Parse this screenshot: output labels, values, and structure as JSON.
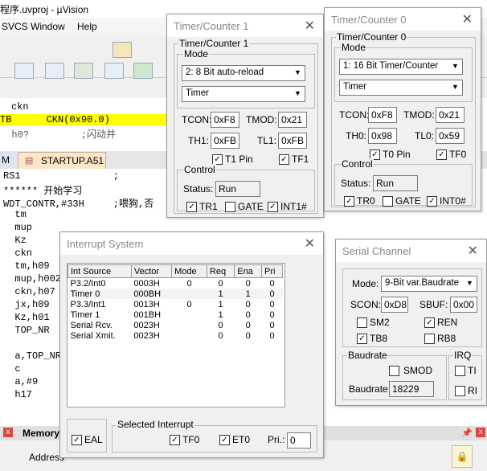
{
  "ide": {
    "title": "程序.uvproj - µVision",
    "menu": [
      "SVCS",
      "Window",
      "Help"
    ],
    "editor_top_lines": [
      "ckn",
      "TB      CKN(0x90.0)",
      "  h0?         ;闪动并"
    ],
    "tabs": [
      "M",
      "STARTUP.A51"
    ],
    "editor_lines": [
      "RS1                ;",
      "****** 开始学习",
      "WDT_CONTR,#33H     ;喂狗,否",
      "  tm",
      "  mup",
      "  Kz",
      "  ckn",
      "  tm,h09",
      "  mup,h002",
      "  ckn,h07",
      "  jx,h09",
      "  Kz,h01",
      "  TOP_NR",
      "",
      "  a,TOP_NR",
      "  c",
      "  a,#9",
      "  h17"
    ],
    "bottom_panel_title": "Memory",
    "bottom_address_label": "Address"
  },
  "timer1": {
    "title": "Timer/Counter 1",
    "group_label": "Timer/Counter 1",
    "mode_label": "Mode",
    "mode_value": "2: 8 Bit auto-reload",
    "type_value": "Timer",
    "tcon_label": "TCON:",
    "tcon": "0xF8",
    "tmod_label": "TMOD:",
    "tmod": "0x21",
    "th_label": "TH1:",
    "th": "0xFB",
    "tl_label": "TL1:",
    "tl": "0xFB",
    "pin_label": "T1 Pin",
    "tf_label": "TF1",
    "control_label": "Control",
    "status_label": "Status:",
    "status": "Run",
    "tr_label": "TR1",
    "gate_label": "GATE",
    "int_label": "INT1#"
  },
  "timer0": {
    "title": "Timer/Counter 0",
    "group_label": "Timer/Counter 0",
    "mode_label": "Mode",
    "mode_value": "1: 16 Bit Timer/Counter",
    "type_value": "Timer",
    "tcon_label": "TCON:",
    "tcon": "0xF8",
    "tmod_label": "TMOD:",
    "tmod": "0x21",
    "th_label": "TH0:",
    "th": "0x98",
    "tl_label": "TL0:",
    "tl": "0x59",
    "pin_label": "T0 Pin",
    "tf_label": "TF0",
    "control_label": "Control",
    "status_label": "Status:",
    "status": "Run",
    "tr_label": "TR0",
    "gate_label": "GATE",
    "int_label": "INT0#"
  },
  "interrupt": {
    "title": "Interrupt System",
    "columns": [
      "Int Source",
      "Vector",
      "Mode",
      "Req",
      "Ena",
      "Pri"
    ],
    "rows": [
      [
        "P3.2/Int0",
        "0003H",
        "0",
        "0",
        "0",
        "0"
      ],
      [
        "Timer 0",
        "000BH",
        "",
        "1",
        "1",
        "0"
      ],
      [
        "P3.3/Int1",
        "0013H",
        "0",
        "1",
        "0",
        "0"
      ],
      [
        "Timer 1",
        "001BH",
        "",
        "1",
        "0",
        "0"
      ],
      [
        "Serial Rcv.",
        "0023H",
        "",
        "0",
        "0",
        "0"
      ],
      [
        "Serial Xmit.",
        "0023H",
        "",
        "0",
        "0",
        "0"
      ]
    ],
    "ea_label": "EAL",
    "selected_label": "Selected Interrupt",
    "tf_label": "TF0",
    "et_label": "ET0",
    "pri_label": "Pri.:",
    "pri": "0"
  },
  "serial": {
    "title": "Serial Channel",
    "mode_label": "Mode:",
    "mode_value": "9-Bit var.Baudrate",
    "scon_label": "SCON:",
    "scon": "0xD8",
    "sbuf_label": "SBUF:",
    "sbuf": "0x00",
    "sm2_label": "SM2",
    "ren_label": "REN",
    "tb8_label": "TB8",
    "rb8_label": "RB8",
    "baud_group": "Baudrate",
    "smod_label": "SMOD",
    "baud_label": "Baudrate:",
    "baud": "18229",
    "irq_group": "IRQ",
    "ti_label": "TI",
    "ri_label": "RI"
  }
}
